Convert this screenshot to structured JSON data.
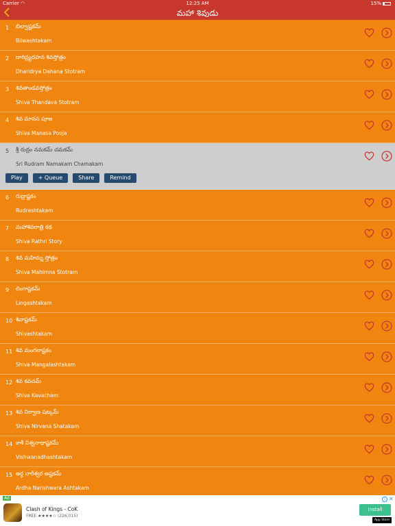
{
  "status_bar": {
    "carrier": "Carrier",
    "time": "12:25 AM",
    "battery": "15%"
  },
  "nav": {
    "title": "మహా శివుడు"
  },
  "items": [
    {
      "num": "1",
      "telugu": "బిల్వాష్టకమ్",
      "english": "Bilwashtakam"
    },
    {
      "num": "2",
      "telugu": "దారిద్ర్యదహన శివస్తోత్రం",
      "english": "Dharidrya Dahana Stotram"
    },
    {
      "num": "3",
      "telugu": "శివతాండవస్తోత్రం",
      "english": "Shiva Thandava Stotram"
    },
    {
      "num": "4",
      "telugu": "శివ మానస పూజ",
      "english": "Shiva Manasa Pooja"
    },
    {
      "num": "5",
      "telugu": "శ్రీ రుద్రం నమకమ్ చమకమ్",
      "english": "Sri Rudram Namakam Chamakam"
    },
    {
      "num": "6",
      "telugu": "రుద్రాష్టకం",
      "english": "Rudrashtakam"
    },
    {
      "num": "7",
      "telugu": "మహాశివరాత్రి కథ",
      "english": "Shiva Rathri Story"
    },
    {
      "num": "8",
      "telugu": "శివ మహిమ్న స్తోత్రం",
      "english": "Shiva Mahimna Stotram"
    },
    {
      "num": "9",
      "telugu": "లింగాష్టకమ్",
      "english": "Lingashtakam"
    },
    {
      "num": "10",
      "telugu": "శివాష్టకమ్",
      "english": "Shivashtakam"
    },
    {
      "num": "11",
      "telugu": "శివ మంగలాష్టకం",
      "english": "Shiva Mangalashtakam"
    },
    {
      "num": "12",
      "telugu": "శివ కవచమ్",
      "english": "Shiva Kavacham"
    },
    {
      "num": "13",
      "telugu": "శివ నిర్వాణ షట్కమ్",
      "english": "Shiva Nirvana Shatakam"
    },
    {
      "num": "14",
      "telugu": "కాశీ విశ్వనాథాష్టకమ్",
      "english": "Vishwanadhashtakam"
    },
    {
      "num": "15",
      "telugu": "అర్ధ నారీశ్వర అష్టకమ్",
      "english": "Ardha Narishwara Ashtakam"
    }
  ],
  "actions": {
    "play": "Play",
    "queue": "+ Queue",
    "share": "Share",
    "remind": "Remind"
  },
  "ad": {
    "tag": "Ad",
    "app_name": "Clash of Kings - CoK",
    "price": "FREE",
    "stars": "★★★★☆",
    "reviews": "(226,015)",
    "install": "Install",
    "store": "App Store"
  },
  "colors": {
    "row_bg": "#f0860f",
    "header_bg": "#c8372d",
    "selected_bg": "#cecece",
    "button_bg": "#264a6e",
    "icon_accent": "#c8372d"
  }
}
